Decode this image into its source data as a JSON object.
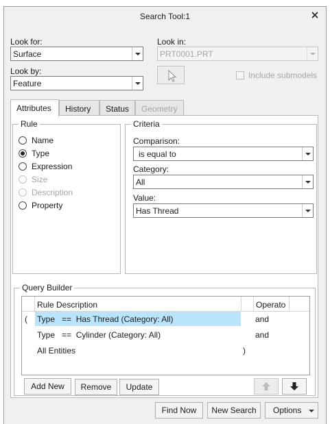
{
  "window": {
    "title": "Search Tool:1"
  },
  "look_for": {
    "label": "Look for:",
    "value": "Surface"
  },
  "look_in": {
    "label": "Look in:",
    "value": "PRT0001.PRT"
  },
  "look_by": {
    "label": "Look by:",
    "value": "Feature"
  },
  "include_submodels": {
    "label": "Include submodels",
    "checked": false
  },
  "tabs": [
    {
      "label": "Attributes",
      "active": true
    },
    {
      "label": "History"
    },
    {
      "label": "Status"
    },
    {
      "label": "Geometry",
      "disabled": true
    }
  ],
  "rule": {
    "title": "Rule",
    "options": [
      {
        "label": "Name",
        "selected": false
      },
      {
        "label": "Type",
        "selected": true
      },
      {
        "label": "Expression",
        "selected": false
      },
      {
        "label": "Size",
        "disabled": true
      },
      {
        "label": "Description",
        "disabled": true
      },
      {
        "label": "Property",
        "selected": false
      }
    ]
  },
  "criteria": {
    "title": "Criteria",
    "comparison": {
      "label": "Comparison:",
      "value": "is equal to"
    },
    "category": {
      "label": "Category:",
      "value": "All"
    },
    "value": {
      "label": "Value:",
      "value": "Has Thread"
    }
  },
  "query_builder": {
    "title": "Query Builder",
    "columns": [
      "Rule Description",
      "Operato"
    ],
    "rows": [
      {
        "open": "(",
        "description": "Type   ==  Has Thread (Category: All)",
        "close": "",
        "operator": "and",
        "selected": true
      },
      {
        "open": "",
        "description": "Type   ==  Cylinder (Category: All)",
        "close": "",
        "operator": "and",
        "selected": false
      },
      {
        "open": "",
        "description": "All Entities",
        "close": ")",
        "operator": "",
        "selected": false
      }
    ],
    "buttons": {
      "add_new": "Add New",
      "remove": "Remove",
      "update": "Update"
    }
  },
  "footer": {
    "find_now": "Find Now",
    "new_search": "New Search",
    "options": "Options"
  },
  "colors": {
    "selection": "#b9e4fb",
    "window_bg": "#f0f0f0",
    "border": "#b8b8b8"
  }
}
